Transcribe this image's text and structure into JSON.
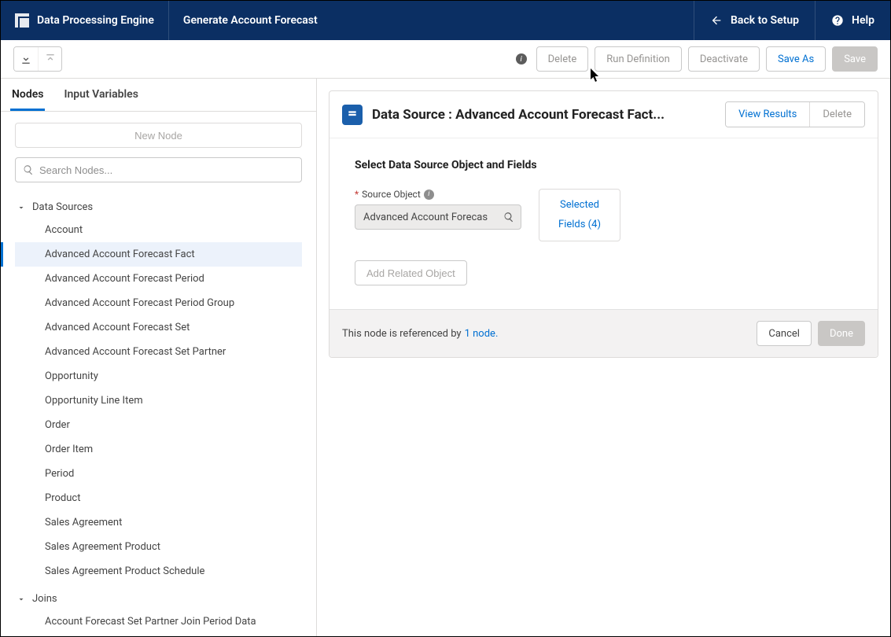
{
  "global": {
    "app_name": "Data Processing Engine",
    "page_title": "Generate Account Forecast",
    "back_label": "Back to Setup",
    "help_label": "Help"
  },
  "toolbar": {
    "delete_label": "Delete",
    "run_label": "Run Definition",
    "deactivate_label": "Deactivate",
    "save_as_label": "Save As",
    "save_label": "Save"
  },
  "sidebar": {
    "tabs": {
      "nodes": "Nodes",
      "input_vars": "Input Variables"
    },
    "new_node_label": "New Node",
    "search_placeholder": "Search Nodes...",
    "groups": {
      "data_sources": {
        "label": "Data Sources",
        "items": [
          "Account",
          "Advanced Account Forecast Fact",
          "Advanced Account Forecast Period",
          "Advanced Account Forecast Period Group",
          "Advanced Account Forecast Set",
          "Advanced Account Forecast Set Partner",
          "Opportunity",
          "Opportunity Line Item",
          "Order",
          "Order Item",
          "Period",
          "Product",
          "Sales Agreement",
          "Sales Agreement Product",
          "Sales Agreement Product Schedule"
        ],
        "selected_index": 1
      },
      "joins": {
        "label": "Joins",
        "items": [
          "Account Forecast Set Partner Join Period Data"
        ]
      }
    }
  },
  "detail": {
    "title_prefix": "Data Source :  ",
    "title_value": "Advanced Account Forecast Fact...",
    "view_results_label": "View Results",
    "delete_label": "Delete",
    "section_heading": "Select Data Source Object and Fields",
    "source_object_label": "Source Object",
    "source_object_value": "Advanced Account Forecas",
    "selected_fields_line1": "Selected",
    "selected_fields_line2": "Fields (4)",
    "add_related_label": "Add Related Object",
    "footer_text": "This node is referenced by",
    "footer_link": "1 node.",
    "cancel_label": "Cancel",
    "done_label": "Done"
  }
}
